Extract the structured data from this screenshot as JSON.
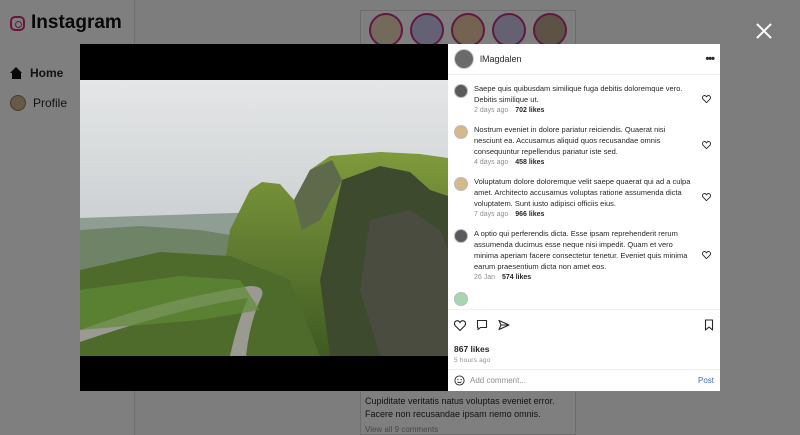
{
  "app": {
    "name": "Instagram"
  },
  "sidebar": {
    "items": [
      {
        "label": "Home",
        "icon": "home-icon"
      },
      {
        "label": "Profile",
        "icon": "avatar"
      }
    ]
  },
  "feed_post": {
    "caption_lines": [
      "Cupiditate veritatis natus voluptas eveniet error.",
      "Facere non recusandae ipsam nemo omnis."
    ],
    "view_comments": "View all 9 comments"
  },
  "modal": {
    "author": "lMagdalen",
    "more_label": "•••",
    "comments": [
      {
        "text": "Saepe quis quibusdam similique fuga debitis doloremque vero. Debitis similique ut.",
        "time": "2 days ago",
        "likes": "702 likes"
      },
      {
        "text": "Nostrum eveniet in dolore pariatur reiciendis. Quaerat nisi nesciunt ea. Accusamus aliquid quos recusandae omnis consequuntur repellendus pariatur iste sed.",
        "time": "4 days ago",
        "likes": "458 likes"
      },
      {
        "text": "Voluptatum dolore doloremque velit saepe quaerat qui ad a culpa amet. Architecto accusamus voluptas ratione assumenda dicta voluptatem. Sunt iusto adipisci officiis eius.",
        "time": "7 days ago",
        "likes": "966 likes"
      },
      {
        "text": "A optio qui perferendis dicta. Esse ipsam reprehenderit rerum assumenda ducimus esse neque nisi impedit. Quam et vero minima aperiam facere consectetur tenetur. Eveniet quis minima earum praesentium dicta non amet eos.",
        "time": "26 Jan",
        "likes": "574 likes"
      }
    ],
    "likes": "867 likes",
    "posted": "5 hours ago",
    "comment_placeholder": "Add comment...",
    "post_label": "Post"
  },
  "colors": {
    "accent": "#3f6ab5",
    "brand": "#d62976"
  }
}
